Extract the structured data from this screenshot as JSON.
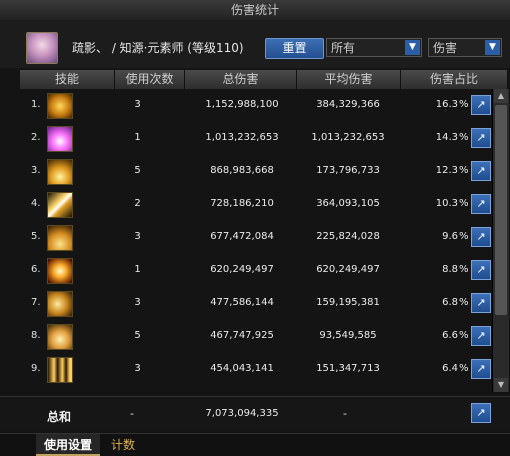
{
  "window": {
    "title": "伤害统计"
  },
  "header": {
    "character": "疏影、 / 知源·元素师 (等级110)",
    "reset_label": "重置",
    "scope_value": "所有",
    "metric_value": "伤害"
  },
  "columns": [
    "技能",
    "使用次数",
    "总伤害",
    "平均伤害",
    "伤害占比"
  ],
  "rows": [
    {
      "index": "1.",
      "icon": "skill-icon-1",
      "uses": "3",
      "total": "1,152,988,100",
      "avg": "384,329,366",
      "pct": "16.3"
    },
    {
      "index": "2.",
      "icon": "skill-icon-2",
      "uses": "1",
      "total": "1,013,232,653",
      "avg": "1,013,232,653",
      "pct": "14.3"
    },
    {
      "index": "3.",
      "icon": "skill-icon-3",
      "uses": "5",
      "total": "868,983,668",
      "avg": "173,796,733",
      "pct": "12.3"
    },
    {
      "index": "4.",
      "icon": "skill-icon-4",
      "uses": "2",
      "total": "728,186,210",
      "avg": "364,093,105",
      "pct": "10.3"
    },
    {
      "index": "5.",
      "icon": "skill-icon-5",
      "uses": "3",
      "total": "677,472,084",
      "avg": "225,824,028",
      "pct": "9.6"
    },
    {
      "index": "6.",
      "icon": "skill-icon-6",
      "uses": "1",
      "total": "620,249,497",
      "avg": "620,249,497",
      "pct": "8.8"
    },
    {
      "index": "7.",
      "icon": "skill-icon-7",
      "uses": "3",
      "total": "477,586,144",
      "avg": "159,195,381",
      "pct": "6.8"
    },
    {
      "index": "8.",
      "icon": "skill-icon-8",
      "uses": "5",
      "total": "467,747,925",
      "avg": "93,549,585",
      "pct": "6.6"
    },
    {
      "index": "9.",
      "icon": "skill-icon-9",
      "uses": "3",
      "total": "454,043,141",
      "avg": "151,347,713",
      "pct": "6.4"
    }
  ],
  "percent_sign": "%",
  "totals": {
    "label": "总和",
    "uses": "-",
    "total": "7,073,094,335",
    "avg": "-"
  },
  "tabs": [
    "使用设置",
    "计数"
  ]
}
